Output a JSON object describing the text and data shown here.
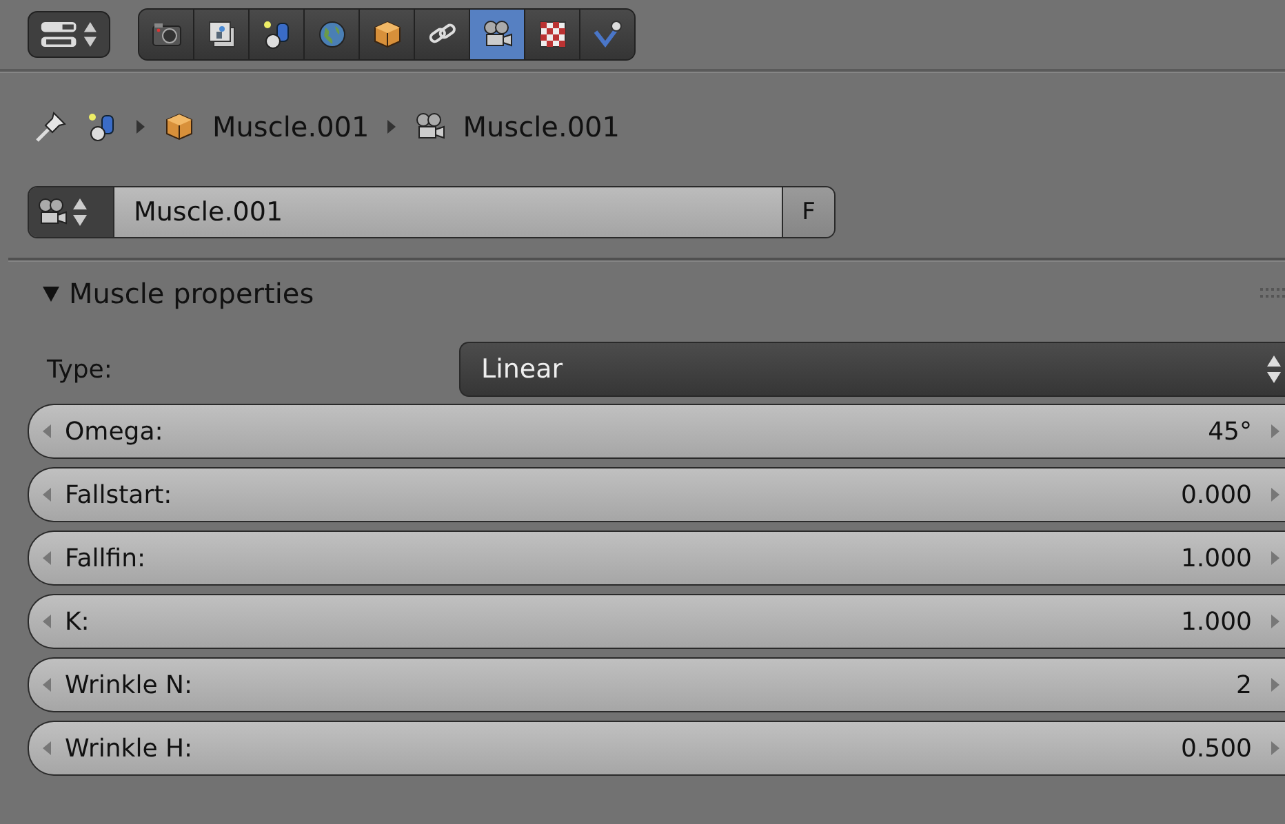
{
  "tabs": [
    {
      "kind": "render",
      "selected": false
    },
    {
      "kind": "layers",
      "selected": false
    },
    {
      "kind": "scene",
      "selected": false
    },
    {
      "kind": "world",
      "selected": false
    },
    {
      "kind": "object",
      "selected": false
    },
    {
      "kind": "constraints",
      "selected": false
    },
    {
      "kind": "muscle",
      "selected": true
    },
    {
      "kind": "texture",
      "selected": false
    },
    {
      "kind": "check",
      "selected": false
    }
  ],
  "breadcrumb": [
    {
      "kind": "scene"
    },
    {
      "kind": "object",
      "label": "Muscle.001"
    },
    {
      "kind": "muscle",
      "label": "Muscle.001"
    }
  ],
  "datablock": {
    "value": "Muscle.001",
    "fake_user": "F"
  },
  "panel": {
    "title": "Muscle properties",
    "expanded": true,
    "type": {
      "label": "Type:",
      "value": "Linear"
    },
    "fields": [
      {
        "label": "Omega:",
        "value": "45°"
      },
      {
        "label": "Fallstart:",
        "value": "0.000"
      },
      {
        "label": "Fallfin:",
        "value": "1.000"
      },
      {
        "label": "K:",
        "value": "1.000"
      },
      {
        "label": "Wrinkle N:",
        "value": "2"
      },
      {
        "label": "Wrinkle H:",
        "value": "0.500"
      }
    ]
  }
}
